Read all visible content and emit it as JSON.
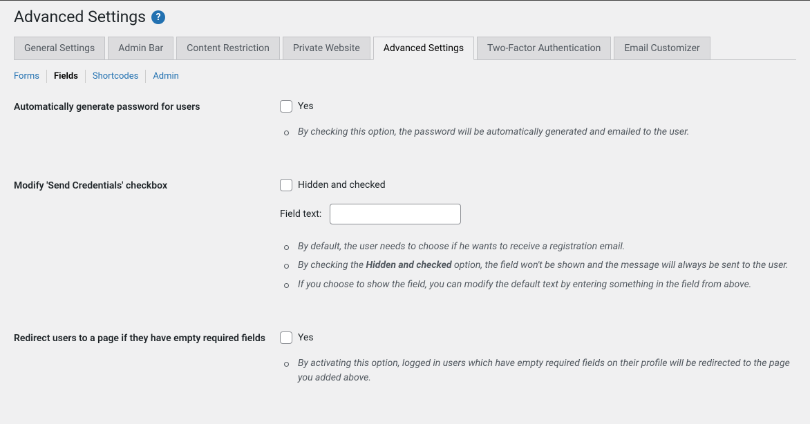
{
  "page_title": "Advanced Settings",
  "nav_tabs": [
    {
      "label": "General Settings",
      "active": false
    },
    {
      "label": "Admin Bar",
      "active": false
    },
    {
      "label": "Content Restriction",
      "active": false
    },
    {
      "label": "Private Website",
      "active": false
    },
    {
      "label": "Advanced Settings",
      "active": true
    },
    {
      "label": "Two-Factor Authentication",
      "active": false
    },
    {
      "label": "Email Customizer",
      "active": false
    }
  ],
  "sub_tabs": [
    {
      "label": "Forms",
      "current": false
    },
    {
      "label": "Fields",
      "current": true
    },
    {
      "label": "Shortcodes",
      "current": false
    },
    {
      "label": "Admin",
      "current": false
    }
  ],
  "settings": {
    "auto_password": {
      "label": "Automatically generate password for users",
      "checkbox_label": "Yes",
      "desc": [
        "By checking this option, the password will be automatically generated and emailed to the user."
      ]
    },
    "send_credentials": {
      "label": "Modify 'Send Credentials' checkbox",
      "checkbox_label": "Hidden and checked",
      "field_text_label": "Field text:",
      "field_text_value": "",
      "desc_pre": "By default, the user needs to choose if he wants to receive a registration email.",
      "desc_mid_before": "By checking the ",
      "desc_mid_strong": "Hidden and checked",
      "desc_mid_after": " option, the field won't be shown and the message will always be sent to the user.",
      "desc_post": "If you choose to show the field, you can modify the default text by entering something in the field from above."
    },
    "redirect_empty": {
      "label": "Redirect users to a page if they have empty required fields",
      "checkbox_label": "Yes",
      "desc": [
        "By activating this option, logged in users which have empty required fields on their profile will be redirected to the page you added above."
      ]
    }
  }
}
